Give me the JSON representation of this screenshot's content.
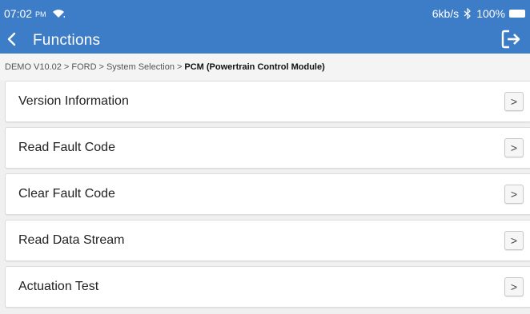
{
  "status_bar": {
    "time": "07:02",
    "ampm": "PM",
    "network_speed": "6kb/s",
    "battery": "100%",
    "icons": [
      "wifi-icon",
      "bluetooth-icon",
      "battery-icon"
    ]
  },
  "title_bar": {
    "title": "Functions",
    "back_icon": "chevron-left-icon",
    "exit_icon": "exit-icon"
  },
  "breadcrumb": {
    "items": [
      "DEMO V10.02",
      "FORD",
      "System Selection"
    ],
    "separator": ">",
    "current": "PCM (Powertrain Control Module)"
  },
  "functions": [
    {
      "label": "Version Information",
      "action_icon": "chevron-right-icon",
      "action_text": ">"
    },
    {
      "label": "Read Fault Code",
      "action_icon": "chevron-right-icon",
      "action_text": ">"
    },
    {
      "label": "Clear Fault Code",
      "action_icon": "chevron-right-icon",
      "action_text": ">"
    },
    {
      "label": "Read Data Stream",
      "action_icon": "chevron-right-icon",
      "action_text": ">"
    },
    {
      "label": "Actuation Test",
      "action_icon": "chevron-right-icon",
      "action_text": ">"
    }
  ],
  "colors": {
    "header_bg": "#3d7cc7",
    "page_bg": "#f0f0f0",
    "item_bg": "#ffffff"
  }
}
